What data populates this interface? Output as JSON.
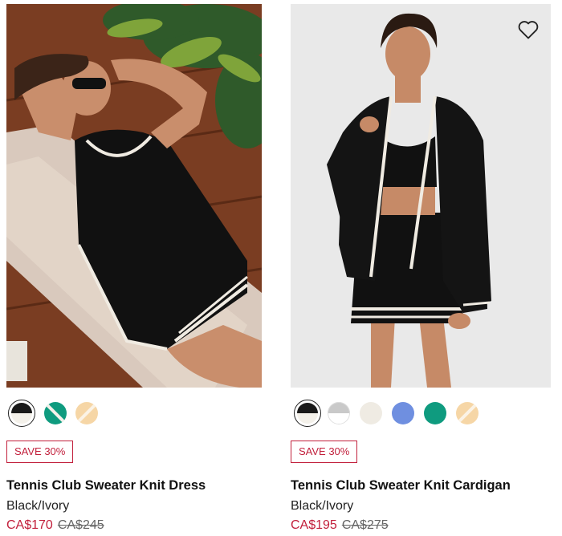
{
  "products": [
    {
      "name": "Tennis Club Sweater Knit Dress",
      "color": "Black/Ivory",
      "badge": "SAVE 30%",
      "sale_price": "CA$170",
      "original_price": "CA$245",
      "image": "woman-lounging-in-black-knit-dress",
      "swatches": [
        {
          "name": "black-ivory",
          "colors": [
            "#1a1a1a",
            "#f4f1ea"
          ],
          "selected": true
        },
        {
          "name": "teal-ivory",
          "colors": [
            "#0f9b7f",
            "#f4f1ea"
          ],
          "selected": false
        },
        {
          "name": "peach-ivory",
          "colors": [
            "#f6d6a6",
            "#fbf3e6"
          ],
          "selected": false
        }
      ]
    },
    {
      "name": "Tennis Club Sweater Knit Cardigan",
      "color": "Black/Ivory",
      "badge": "SAVE 30%",
      "sale_price": "CA$195",
      "original_price": "CA$275",
      "image": "model-in-black-knit-cardigan-and-skirt",
      "wishlist_icon": "heart-outline-icon",
      "swatches": [
        {
          "name": "black-ivory",
          "colors": [
            "#1a1a1a",
            "#f4f1ea"
          ],
          "selected": true
        },
        {
          "name": "grey-white",
          "colors": [
            "#c9c9c9",
            "#ffffff"
          ],
          "selected": false
        },
        {
          "name": "ivory",
          "colors": [
            "#efebe3",
            "#efebe3"
          ],
          "selected": false
        },
        {
          "name": "blue",
          "colors": [
            "#6f8fe0",
            "#6f8fe0"
          ],
          "selected": false
        },
        {
          "name": "teal",
          "colors": [
            "#0f9b7f",
            "#0f9b7f"
          ],
          "selected": false
        },
        {
          "name": "peach-ivory",
          "colors": [
            "#f6d6a6",
            "#fbf3e6"
          ],
          "selected": false
        }
      ]
    }
  ],
  "theme": {
    "sale_color": "#c2203c",
    "text_color": "#111111"
  }
}
